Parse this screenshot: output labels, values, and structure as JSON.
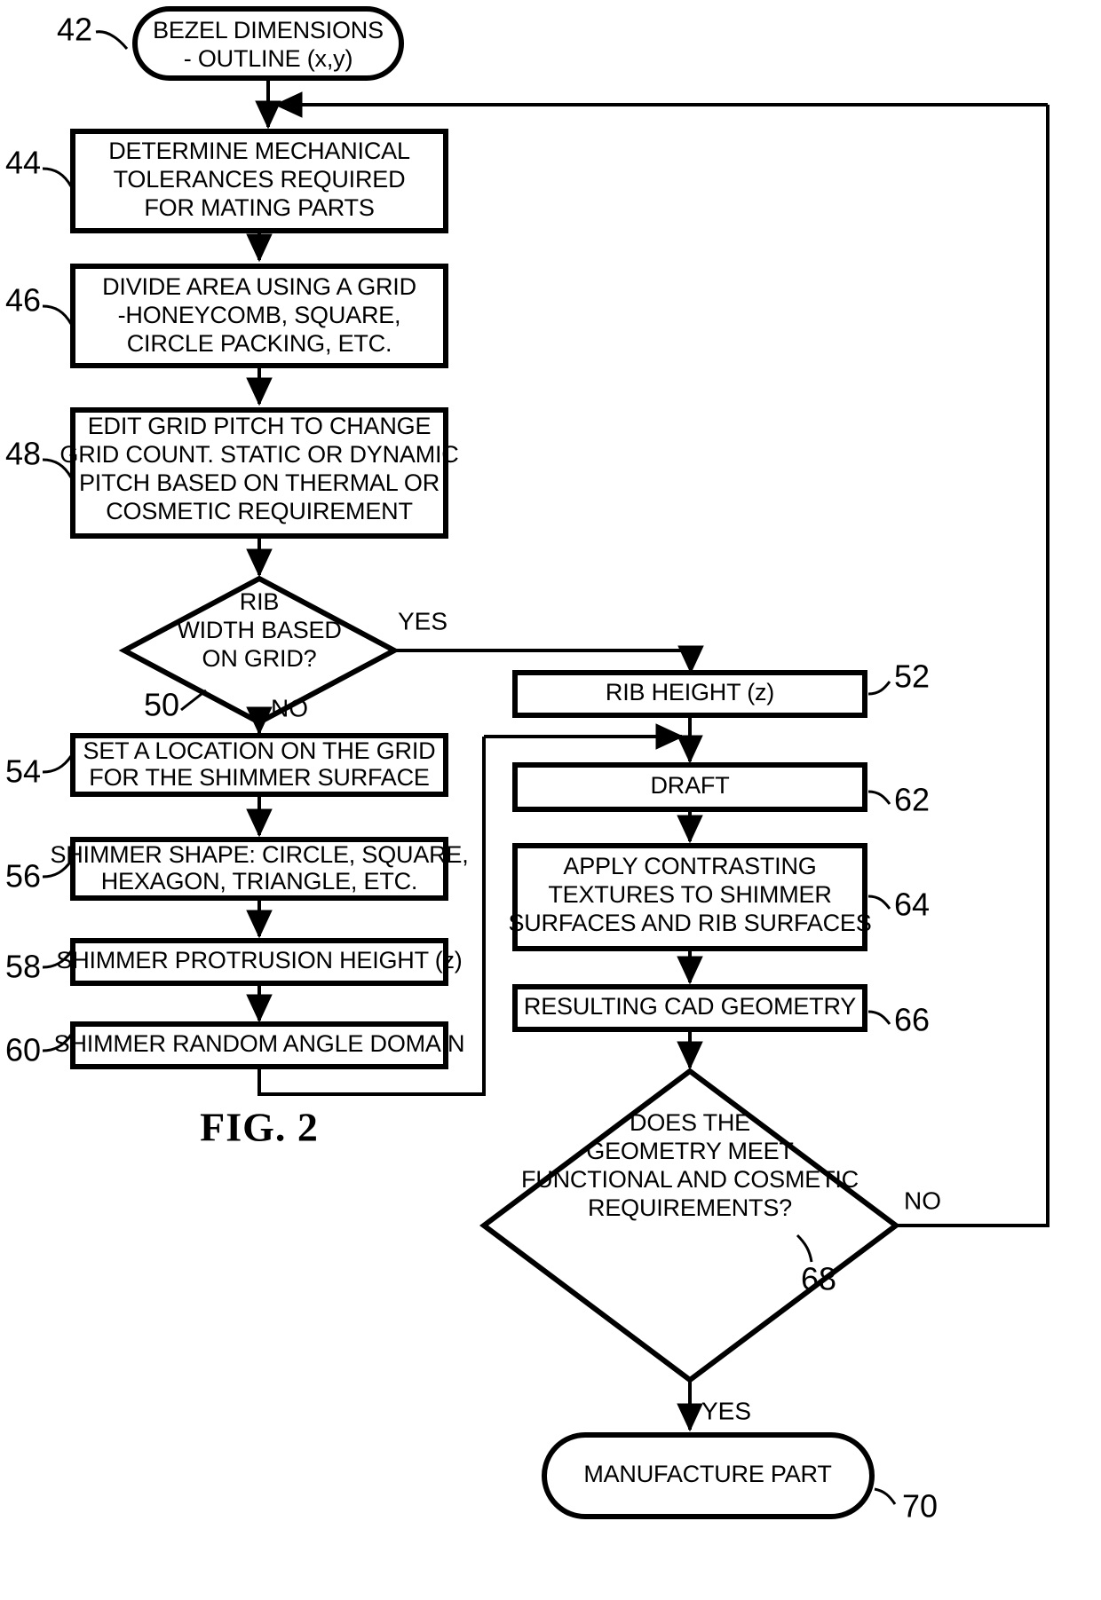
{
  "figure": {
    "caption": "FIG. 2",
    "type": "flowchart"
  },
  "nodes": {
    "n42": {
      "ref": "42",
      "shape": "terminator",
      "lines": [
        "BEZEL DIMENSIONS",
        "- OUTLINE (x,y)"
      ]
    },
    "n44": {
      "ref": "44",
      "shape": "process",
      "lines": [
        "DETERMINE MECHANICAL",
        "TOLERANCES REQUIRED",
        "FOR MATING PARTS"
      ]
    },
    "n46": {
      "ref": "46",
      "shape": "process",
      "lines": [
        "DIVIDE AREA USING A GRID",
        "-HONEYCOMB, SQUARE,",
        "CIRCLE PACKING, ETC."
      ]
    },
    "n48": {
      "ref": "48",
      "shape": "process",
      "lines": [
        "EDIT GRID PITCH TO CHANGE",
        "GRID COUNT. STATIC OR DYNAMIC",
        "PITCH BASED ON THERMAL OR",
        "COSMETIC REQUIREMENT"
      ]
    },
    "n50": {
      "ref": "50",
      "shape": "decision",
      "lines": [
        "RIB",
        "WIDTH BASED",
        "ON GRID?"
      ]
    },
    "n52": {
      "ref": "52",
      "shape": "process",
      "lines": [
        "RIB HEIGHT (z)"
      ]
    },
    "n54": {
      "ref": "54",
      "shape": "process",
      "lines": [
        "SET A LOCATION ON THE GRID",
        "FOR THE SHIMMER SURFACE"
      ]
    },
    "n56": {
      "ref": "56",
      "shape": "process",
      "lines": [
        "SHIMMER SHAPE: CIRCLE, SQUARE,",
        "HEXAGON, TRIANGLE, ETC."
      ]
    },
    "n58": {
      "ref": "58",
      "shape": "process",
      "lines": [
        "SHIMMER PROTRUSION HEIGHT (z)"
      ]
    },
    "n60": {
      "ref": "60",
      "shape": "process",
      "lines": [
        "SHIMMER RANDOM ANGLE DOMAIN"
      ]
    },
    "n62": {
      "ref": "62",
      "shape": "process",
      "lines": [
        "DRAFT"
      ]
    },
    "n64": {
      "ref": "64",
      "shape": "process",
      "lines": [
        "APPLY CONTRASTING",
        "TEXTURES TO SHIMMER",
        "SURFACES AND RIB SURFACES"
      ]
    },
    "n66": {
      "ref": "66",
      "shape": "process",
      "lines": [
        "RESULTING CAD GEOMETRY"
      ]
    },
    "n68": {
      "ref": "68",
      "shape": "decision",
      "lines": [
        "DOES THE",
        "GEOMETRY MEET",
        "FUNCTIONAL AND COSMETIC",
        "REQUIREMENTS?"
      ]
    },
    "n70": {
      "ref": "70",
      "shape": "terminator",
      "lines": [
        "MANUFACTURE PART"
      ]
    }
  },
  "edge_labels": {
    "yes_rib": "YES",
    "no_rib": "NO",
    "no_geom": "NO",
    "yes_geom": "YES"
  },
  "colors": {
    "line": "#000000",
    "fill": "#ffffff"
  }
}
